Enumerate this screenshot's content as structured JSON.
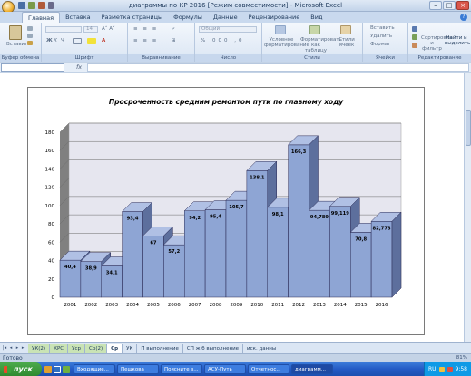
{
  "window": {
    "title": "диаграммы по КР 2016  [Режим совместимости] - Microsoft Excel"
  },
  "ribbon_tabs": [
    "Главная",
    "Вставка",
    "Разметка страницы",
    "Формулы",
    "Данные",
    "Рецензирование",
    "Вид"
  ],
  "ribbon": {
    "clipboard": {
      "paste": "Вставить",
      "label": "Буфер обмена"
    },
    "font": {
      "name": "",
      "size": "14",
      "label": "Шрифт"
    },
    "alignment": {
      "label": "Выравнивание"
    },
    "number": {
      "format": "Общий",
      "label": "Число"
    },
    "styles": {
      "conditional": "Условное форматирование",
      "as_table": "Форматировать как таблицу",
      "cell_styles": "Стили ячеек",
      "label": "Стили"
    },
    "cells": {
      "insert": "Вставить",
      "delete": "Удалить",
      "format": "Формат",
      "label": "Ячейки"
    },
    "editing": {
      "sort": "Сортировка и фильтр",
      "find": "Найти и выделить",
      "label": "Редактирование"
    }
  },
  "formula_bar": {
    "name_box": "",
    "fx": "fx",
    "content": ""
  },
  "chart_data": {
    "type": "bar",
    "title": "Просроченность средним ремонтом пути по главному ходу",
    "categories": [
      "2001",
      "2002",
      "2003",
      "2004",
      "2005",
      "2006",
      "2007",
      "2008",
      "2009",
      "2010",
      "2011",
      "2012",
      "2013",
      "2014",
      "2015",
      "2016"
    ],
    "values": [
      40.4,
      38.9,
      34.1,
      93.4,
      67,
      57.2,
      94.2,
      95.4,
      105.7,
      138.1,
      98.1,
      166.3,
      94.789,
      99.119,
      70.8,
      82.773
    ],
    "value_labels": [
      "40,4",
      "38,9",
      "34,1",
      "93,4",
      "67",
      "57,2",
      "94,2",
      "95,4",
      "105,7",
      "138,1",
      "98,1",
      "166,3",
      "94,789",
      "99,119",
      "70,8",
      "82,773"
    ],
    "ylim": [
      0,
      180
    ],
    "yticks": [
      "0",
      "20",
      "40",
      "60",
      "80",
      "100",
      "120",
      "140",
      "160",
      "180"
    ],
    "grid": true,
    "bar_color": "#8ea5d4",
    "xlabel": "",
    "ylabel": ""
  },
  "sheet_tabs": [
    {
      "label": "УК(2)",
      "active": false
    },
    {
      "label": "КРС",
      "active": false
    },
    {
      "label": "Уср",
      "active": false
    },
    {
      "label": "Ср(2)",
      "active": false
    },
    {
      "label": "Ср",
      "active": true
    },
    {
      "label": "УК",
      "active": false
    },
    {
      "label": "П выполнение",
      "active": false
    },
    {
      "label": "СП ж.б выполнение",
      "active": false
    },
    {
      "label": "иск. данны",
      "active": false
    }
  ],
  "status": {
    "ready": "Готово",
    "zoom": "81%"
  },
  "taskbar": {
    "start": "пуск",
    "tasks": [
      "Входящие...",
      "Пешкова",
      "Поясните з...",
      "АСУ-Путь",
      "Отчетнос...",
      "диаграмм..."
    ],
    "active_task": 5,
    "tray": {
      "lang": "RU",
      "time": "9:58"
    }
  }
}
